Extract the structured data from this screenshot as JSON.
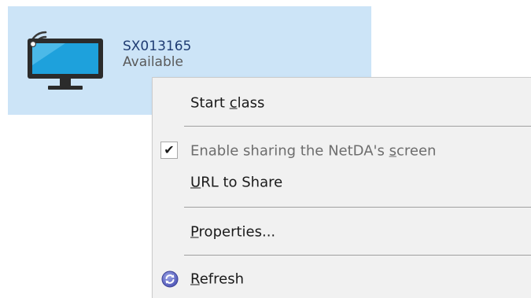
{
  "device": {
    "name": "SX013165",
    "status": "Available",
    "icon": "wireless-display-icon"
  },
  "menu": {
    "start_class_prefix": "Start ",
    "start_class_mnemonic": "c",
    "start_class_suffix": "lass",
    "enable_sharing_prefix": "Enable sharing the NetDA's ",
    "enable_sharing_mnemonic": "s",
    "enable_sharing_suffix": "creen",
    "enable_sharing_checked": true,
    "url_share_mnemonic": "U",
    "url_share_suffix": "RL to Share",
    "properties_mnemonic": "P",
    "properties_suffix": "roperties...",
    "refresh_mnemonic": "R",
    "refresh_suffix": "efresh"
  },
  "icons": {
    "check": "check-icon",
    "refresh": "refresh-icon"
  }
}
